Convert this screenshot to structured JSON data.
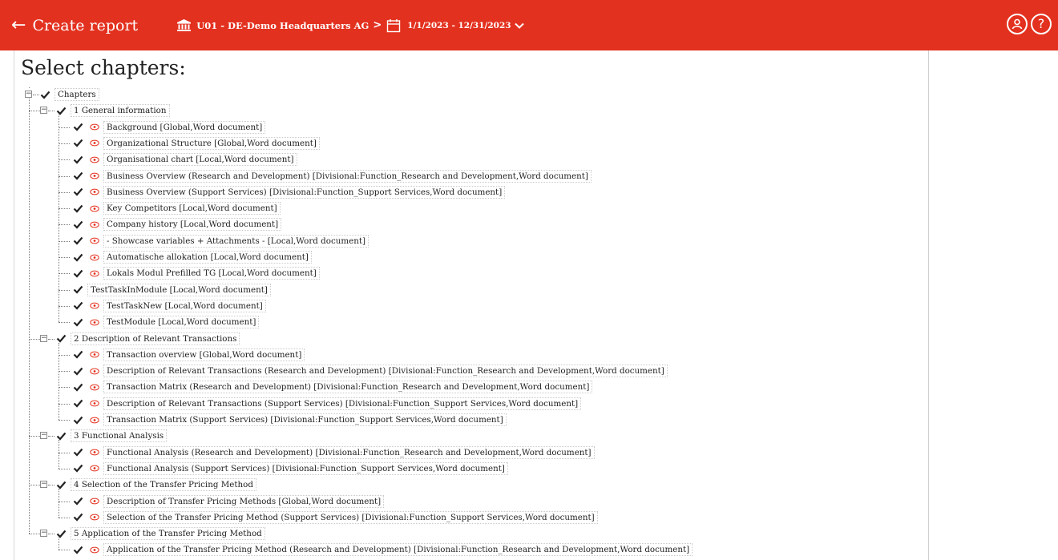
{
  "header": {
    "back_label": "Create report",
    "entity": "U01 - DE-Demo Headquarters AG",
    "date_range": "1/1/2023 - 12/31/2023",
    "colors": {
      "brand": "#e3311f",
      "eye": "#e3311f"
    }
  },
  "page": {
    "title": "Select chapters:"
  },
  "tree": {
    "root": "Chapters",
    "chapters": [
      {
        "label": "1 General information",
        "items": [
          {
            "label": "Background [Global,Word document]",
            "eye": true
          },
          {
            "label": "Organizational Structure [Global,Word document]",
            "eye": true
          },
          {
            "label": "Organisational chart [Local,Word document]",
            "eye": true
          },
          {
            "label": "Business Overview (Research and Development) [Divisional:Function_Research and Development,Word document]",
            "eye": true
          },
          {
            "label": "Business Overview (Support Services) [Divisional:Function_Support Services,Word document]",
            "eye": true
          },
          {
            "label": "Key Competitors [Local,Word document]",
            "eye": true
          },
          {
            "label": "Company history [Local,Word document]",
            "eye": true
          },
          {
            "label": "- Showcase variables + Attachments - [Local,Word document]",
            "eye": true
          },
          {
            "label": "Automatische allokation [Local,Word document]",
            "eye": true
          },
          {
            "label": "Lokals Modul Prefilled TG [Local,Word document]",
            "eye": true
          },
          {
            "label": "TestTaskInModule [Local,Word document]",
            "eye": false
          },
          {
            "label": "TestTaskNew [Local,Word document]",
            "eye": true
          },
          {
            "label": "TestModule [Local,Word document]",
            "eye": true
          }
        ]
      },
      {
        "label": "2 Description of Relevant Transactions",
        "items": [
          {
            "label": "Transaction overview [Global,Word document]",
            "eye": true
          },
          {
            "label": "Description of Relevant Transactions (Research and Development) [Divisional:Function_Research and Development,Word document]",
            "eye": true
          },
          {
            "label": "Transaction Matrix (Research and Development) [Divisional:Function_Research and Development,Word document]",
            "eye": true
          },
          {
            "label": "Description of Relevant Transactions (Support Services) [Divisional:Function_Support Services,Word document]",
            "eye": true
          },
          {
            "label": "Transaction Matrix (Support Services) [Divisional:Function_Support Services,Word document]",
            "eye": true
          }
        ]
      },
      {
        "label": "3 Functional Analysis",
        "items": [
          {
            "label": "Functional Analysis (Research and Development) [Divisional:Function_Research and Development,Word document]",
            "eye": true
          },
          {
            "label": "Functional Analysis (Support Services) [Divisional:Function_Support Services,Word document]",
            "eye": true
          }
        ]
      },
      {
        "label": "4 Selection of the Transfer Pricing Method",
        "items": [
          {
            "label": "Description of Transfer Pricing Methods [Global,Word document]",
            "eye": true
          },
          {
            "label": "Selection of the Transfer Pricing Method (Support Services) [Divisional:Function_Support Services,Word document]",
            "eye": true
          }
        ]
      },
      {
        "label": "5 Application of the Transfer Pricing Method",
        "items": [
          {
            "label": "Application of the Transfer Pricing Method (Research and Development) [Divisional:Function_Research and Development,Word document]",
            "eye": true
          }
        ]
      }
    ]
  }
}
